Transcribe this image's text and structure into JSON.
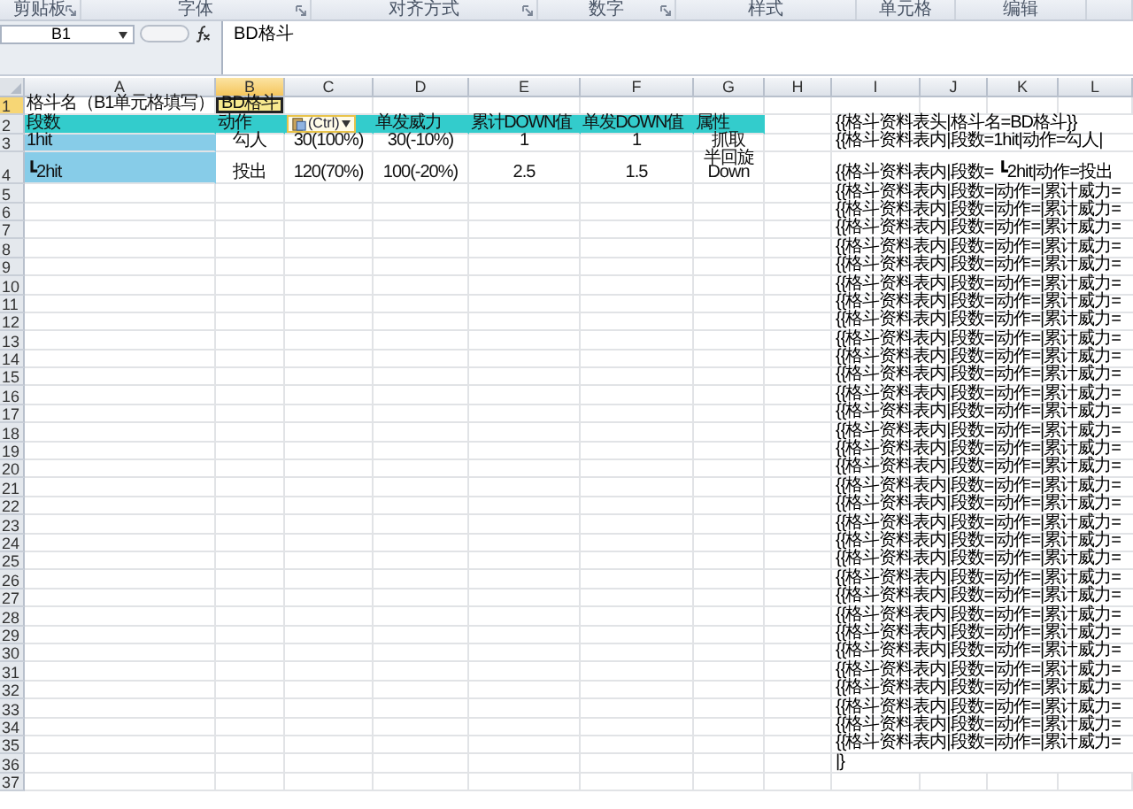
{
  "ribbon_groups": [
    {
      "label": "剪贴板",
      "launcher": true
    },
    {
      "label": "字体",
      "launcher": true
    },
    {
      "label": "对齐方式",
      "launcher": true
    },
    {
      "label": "数字",
      "launcher": true
    },
    {
      "label": "样式",
      "launcher": false
    },
    {
      "label": "单元格",
      "launcher": false
    },
    {
      "label": "编辑",
      "launcher": false
    }
  ],
  "name_box": "B1",
  "formula": "BD格斗",
  "columns": [
    {
      "label": "A",
      "selected": false
    },
    {
      "label": "B",
      "selected": true
    },
    {
      "label": "C",
      "selected": false
    },
    {
      "label": "D",
      "selected": false
    },
    {
      "label": "E",
      "selected": false
    },
    {
      "label": "F",
      "selected": false
    },
    {
      "label": "G",
      "selected": false
    },
    {
      "label": "H",
      "selected": false
    },
    {
      "label": "I",
      "selected": false
    },
    {
      "label": "J",
      "selected": false
    },
    {
      "label": "K",
      "selected": false
    },
    {
      "label": "L",
      "selected": false
    }
  ],
  "rows": [
    {
      "number": "1",
      "selected": true,
      "cells": [
        {
          "kind": "label",
          "text": "格斗名（B1单元格填写）"
        },
        {
          "kind": "active",
          "text": "BD格斗"
        }
      ]
    },
    {
      "number": "2",
      "selected": false,
      "cells": [
        {
          "kind": "header",
          "text": "段数"
        },
        {
          "kind": "header",
          "text": "动作"
        },
        {
          "kind": "header"
        },
        {
          "kind": "header",
          "text": "单发威力"
        },
        {
          "kind": "header",
          "text": "累计DOWN值"
        },
        {
          "kind": "header",
          "text": "单发DOWN值"
        },
        {
          "kind": "header",
          "text": "属性"
        }
      ],
      "template_text": "{{格斗资料表头|格斗名=BD格斗}}"
    },
    {
      "number": "3",
      "selected": false,
      "cells": [
        {
          "kind": "key",
          "text": "1hit"
        },
        {
          "kind": "value",
          "text": "勾人"
        },
        {
          "kind": "value",
          "text": "30(100%)"
        },
        {
          "kind": "value",
          "text": "30(-10%)"
        },
        {
          "kind": "value",
          "text": "1"
        },
        {
          "kind": "value",
          "text": "1"
        },
        {
          "kind": "value",
          "text": "抓取"
        }
      ],
      "template_text": "{{格斗资料表内|段数=1hit|动作=勾人|"
    },
    {
      "number": "4",
      "selected": false,
      "cells": [
        {
          "kind": "key",
          "text": "┗2hit"
        },
        {
          "kind": "value",
          "text": "投出"
        },
        {
          "kind": "value",
          "text": "120(70%)"
        },
        {
          "kind": "value",
          "text": "100(-20%)"
        },
        {
          "kind": "value",
          "text": "2.5"
        },
        {
          "kind": "value",
          "text": "1.5"
        },
        {
          "kind": "value",
          "text": "半回旋 Down"
        }
      ],
      "template_text": "{{格斗资料表内|段数= ┗2hit|动作=投出"
    },
    {
      "number": "5",
      "selected": false,
      "cells": [],
      "template_text": "{{格斗资料表内|段数=|动作=|累计威力="
    },
    {
      "number": "6",
      "selected": false,
      "cells": [],
      "template_text": "{{格斗资料表内|段数=|动作=|累计威力="
    },
    {
      "number": "7",
      "selected": false,
      "cells": [],
      "template_text": "{{格斗资料表内|段数=|动作=|累计威力="
    },
    {
      "number": "8",
      "selected": false,
      "cells": [],
      "template_text": "{{格斗资料表内|段数=|动作=|累计威力="
    },
    {
      "number": "9",
      "selected": false,
      "cells": [],
      "template_text": "{{格斗资料表内|段数=|动作=|累计威力="
    },
    {
      "number": "10",
      "selected": false,
      "cells": [],
      "template_text": "{{格斗资料表内|段数=|动作=|累计威力="
    },
    {
      "number": "11",
      "selected": false,
      "cells": [],
      "template_text": "{{格斗资料表内|段数=|动作=|累计威力="
    },
    {
      "number": "12",
      "selected": false,
      "cells": [],
      "template_text": "{{格斗资料表内|段数=|动作=|累计威力="
    },
    {
      "number": "13",
      "selected": false,
      "cells": [],
      "template_text": "{{格斗资料表内|段数=|动作=|累计威力="
    },
    {
      "number": "14",
      "selected": false,
      "cells": [],
      "template_text": "{{格斗资料表内|段数=|动作=|累计威力="
    },
    {
      "number": "15",
      "selected": false,
      "cells": [],
      "template_text": "{{格斗资料表内|段数=|动作=|累计威力="
    },
    {
      "number": "16",
      "selected": false,
      "cells": [],
      "template_text": "{{格斗资料表内|段数=|动作=|累计威力="
    },
    {
      "number": "17",
      "selected": false,
      "cells": [],
      "template_text": "{{格斗资料表内|段数=|动作=|累计威力="
    },
    {
      "number": "18",
      "selected": false,
      "cells": [],
      "template_text": "{{格斗资料表内|段数=|动作=|累计威力="
    },
    {
      "number": "19",
      "selected": false,
      "cells": [],
      "template_text": "{{格斗资料表内|段数=|动作=|累计威力="
    },
    {
      "number": "20",
      "selected": false,
      "cells": [],
      "template_text": "{{格斗资料表内|段数=|动作=|累计威力="
    },
    {
      "number": "21",
      "selected": false,
      "cells": [],
      "template_text": "{{格斗资料表内|段数=|动作=|累计威力="
    },
    {
      "number": "22",
      "selected": false,
      "cells": [],
      "template_text": "{{格斗资料表内|段数=|动作=|累计威力="
    },
    {
      "number": "23",
      "selected": false,
      "cells": [],
      "template_text": "{{格斗资料表内|段数=|动作=|累计威力="
    },
    {
      "number": "24",
      "selected": false,
      "cells": [],
      "template_text": "{{格斗资料表内|段数=|动作=|累计威力="
    },
    {
      "number": "25",
      "selected": false,
      "cells": [],
      "template_text": "{{格斗资料表内|段数=|动作=|累计威力="
    },
    {
      "number": "26",
      "selected": false,
      "cells": [],
      "template_text": "{{格斗资料表内|段数=|动作=|累计威力="
    },
    {
      "number": "27",
      "selected": false,
      "cells": [],
      "template_text": "{{格斗资料表内|段数=|动作=|累计威力="
    },
    {
      "number": "28",
      "selected": false,
      "cells": [],
      "template_text": "{{格斗资料表内|段数=|动作=|累计威力="
    },
    {
      "number": "29",
      "selected": false,
      "cells": [],
      "template_text": "{{格斗资料表内|段数=|动作=|累计威力="
    },
    {
      "number": "30",
      "selected": false,
      "cells": [],
      "template_text": "{{格斗资料表内|段数=|动作=|累计威力="
    },
    {
      "number": "31",
      "selected": false,
      "cells": [],
      "template_text": "{{格斗资料表内|段数=|动作=|累计威力="
    },
    {
      "number": "32",
      "selected": false,
      "cells": [],
      "template_text": "{{格斗资料表内|段数=|动作=|累计威力="
    },
    {
      "number": "33",
      "selected": false,
      "cells": [],
      "template_text": "{{格斗资料表内|段数=|动作=|累计威力="
    },
    {
      "number": "34",
      "selected": false,
      "cells": [],
      "template_text": "{{格斗资料表内|段数=|动作=|累计威力="
    },
    {
      "number": "35",
      "selected": false,
      "cells": [],
      "template_text": "{{格斗资料表内|段数=|动作=|累计威力="
    },
    {
      "number": "36",
      "selected": false,
      "cells": [],
      "template_text": "|}"
    },
    {
      "number": "37",
      "selected": false,
      "cells": []
    }
  ],
  "paste_options": {
    "label": "(Ctrl)"
  }
}
